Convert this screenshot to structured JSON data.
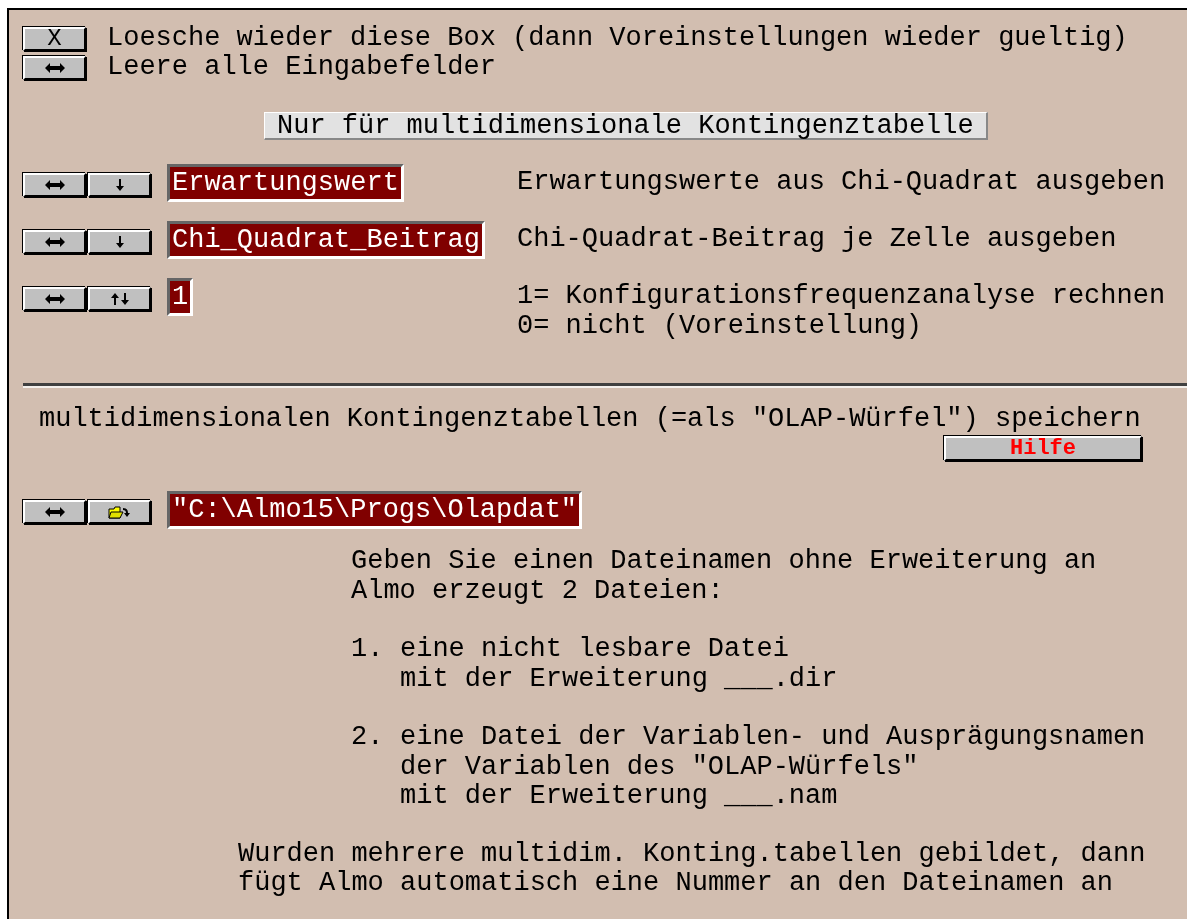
{
  "header_actions": [
    {
      "kind": "delete",
      "key": "X",
      "label": "Loesche wieder diese Box (dann Voreinstellungen wieder gueltig)"
    },
    {
      "kind": "clear",
      "label": "Leere alle Eingabefelder"
    }
  ],
  "section_button": "Nur für multidimensionale Kontingenztabelle",
  "options": [
    {
      "buttons": [
        {
          "kind": "clear"
        },
        {
          "kind": "down"
        }
      ],
      "value": "Erwartungswert",
      "description": [
        "Erwartungswerte aus Chi-Quadrat ausgeben"
      ]
    },
    {
      "buttons": [
        {
          "kind": "clear"
        },
        {
          "kind": "down"
        }
      ],
      "value": "Chi_Quadrat_Beitrag",
      "description": [
        "Chi-Quadrat-Beitrag je Zelle ausgeben"
      ]
    },
    {
      "buttons": [
        {
          "kind": "clear"
        },
        {
          "kind": "updown"
        }
      ],
      "value": "1",
      "description": [
        "1= Konfigurationsfrequenzanalyse rechnen",
        "0= nicht (Voreinstellung)"
      ]
    }
  ],
  "olap": {
    "title": "multidimensionalen Kontingenztabellen (=als \"OLAP-Würfel\") speichern",
    "help_button": "Hilfe",
    "path": {
      "buttons": [
        {
          "kind": "clear"
        },
        {
          "kind": "folder"
        }
      ],
      "value": "\"C:\\Almo15\\Progs\\Olapdat\""
    },
    "intro": [
      "Geben Sie einen Dateinamen ohne Erweiterung an",
      "Almo erzeugt 2 Dateien:"
    ],
    "items": [
      {
        "number": "1.",
        "lines": [
          "eine nicht lesbare Datei",
          "mit der Erweiterung ___.dir"
        ]
      },
      {
        "number": "2.",
        "lines": [
          "eine Datei der Variablen- und Ausprägungsnamen",
          "der Variablen des \"OLAP-Würfels\"",
          "mit der Erweiterung ___.nam"
        ]
      }
    ],
    "footer": [
      "Wurden mehrere multidim. Konting.tabellen gebildet, dann",
      "fügt Almo automatisch eine Nummer an den Dateinamen an"
    ]
  }
}
